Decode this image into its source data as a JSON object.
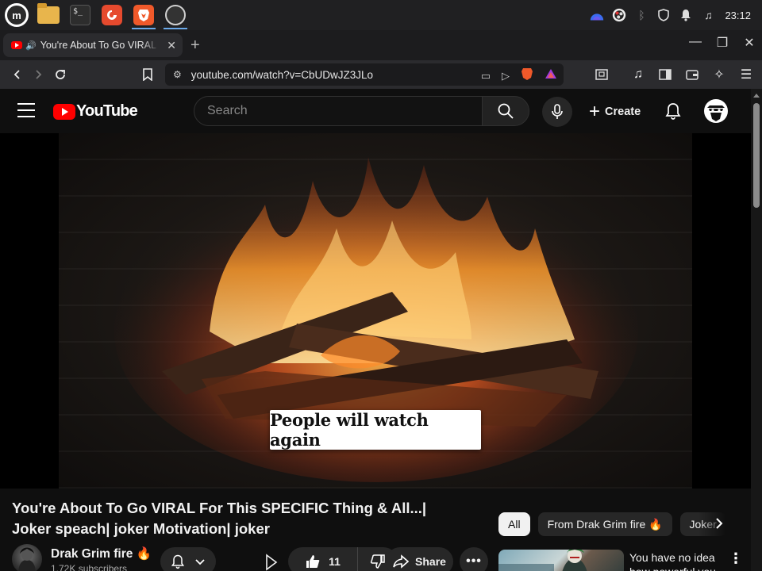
{
  "os": {
    "apps": [
      "mint-menu",
      "files",
      "terminal",
      "firefox",
      "brave",
      "obs"
    ],
    "clock": "23:12"
  },
  "browser": {
    "tab_title": "You're About To Go VIRAL For This SPECIFIC Thing & All...",
    "url": "youtube.com/watch?v=CbUDwJZ3JLo"
  },
  "youtube": {
    "logo_text": "YouTube",
    "search_placeholder": "Search",
    "create_label": "Create"
  },
  "video": {
    "caption": "People will watch again",
    "title": "You're About To Go VIRAL For This SPECIFIC Thing & All...| Joker speach| joker Motivation| joker"
  },
  "channel": {
    "name": "Drak Grim fire 🔥",
    "subscribers": "1.72K subscribers"
  },
  "actions": {
    "like_count": "11",
    "share_label": "Share",
    "more_label": "•••"
  },
  "recommendations": {
    "chips": [
      "All",
      "From Drak Grim fire 🔥",
      "Joker"
    ],
    "first_title": "You have no idea how powerful you"
  },
  "colors": {
    "background": "#0f0f0f",
    "youtube_red": "#ff0000",
    "chip_active": "#f1f1f1",
    "surface": "#272727"
  }
}
